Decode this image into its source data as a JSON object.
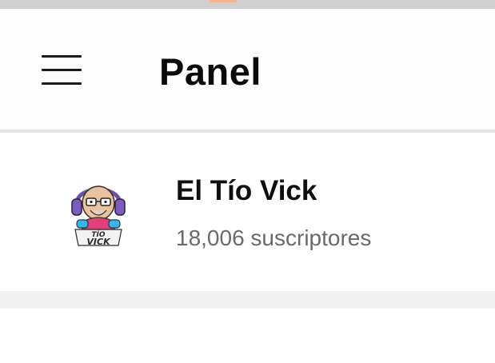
{
  "app_bar": {
    "menu_icon": "hamburger-menu-icon",
    "title": "Panel"
  },
  "channel": {
    "name": "El Tío Vick",
    "subscribers": "18,006 suscriptores",
    "avatar_icon": "channel-avatar",
    "avatar_logo_text": "TÍO VICK"
  },
  "colors": {
    "status_strip": "#cfcfcf",
    "status_accent": "#f3b48e",
    "title_text": "#0b0b0b",
    "subtitle_text": "#6a6a6a",
    "divider": "#e4e4e4",
    "section_gap": "#f0f0f0"
  }
}
